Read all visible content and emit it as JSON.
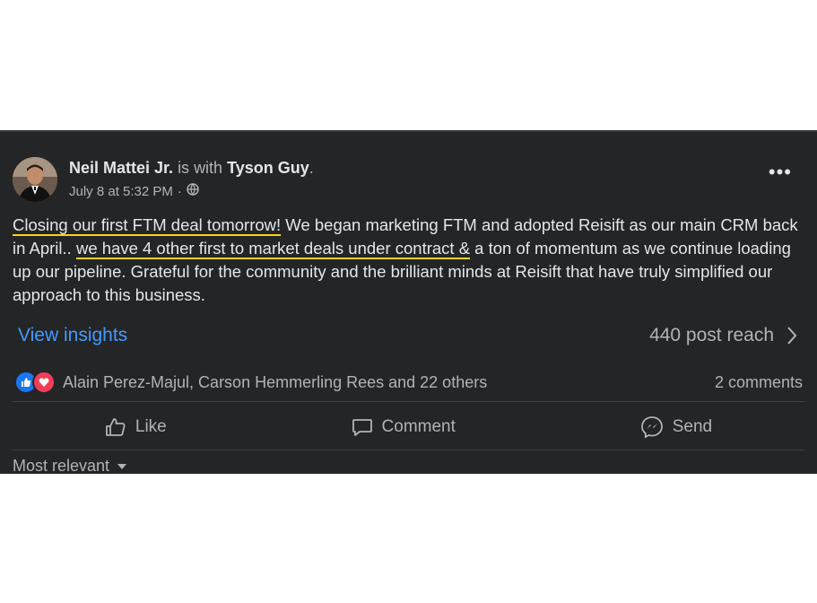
{
  "post": {
    "author": "Neil Mattei Jr.",
    "with_text": "is with",
    "tagged": "Tyson Guy",
    "tagged_suffix": ".",
    "timestamp": "July 8 at 5:32 PM",
    "separator": "·",
    "privacy_icon": "globe-icon",
    "more_label": "•••",
    "text": {
      "part1": "Closing our first FTM deal tomorrow!",
      "part2": " We began marketing FTM and adopted Reisift as our main CRM back in April.. ",
      "part3": "we have 4 other first to market deals under contract &",
      "part4": " a ton of momentum as we continue loading up our pipeline. Grateful for the community and the brilliant minds at Reisift that have truly simplified our approach to this business."
    },
    "highlight_color": "#f7d21e"
  },
  "insights": {
    "link": "View insights",
    "reach": "440 post reach"
  },
  "reactions": {
    "icons": [
      "like-icon",
      "love-icon"
    ],
    "summary": "Alain Perez-Majul, Carson Hemmerling Rees and 22 others",
    "comments": "2 comments"
  },
  "actions": {
    "like": "Like",
    "comment": "Comment",
    "send": "Send"
  },
  "sort": {
    "label": "Most relevant"
  },
  "colors": {
    "background": "#242526",
    "text": "#e4e6eb",
    "muted": "#b0b3b8",
    "link": "#4599ff",
    "like_blue": "#1877f2",
    "love_red": "#f33e58"
  }
}
